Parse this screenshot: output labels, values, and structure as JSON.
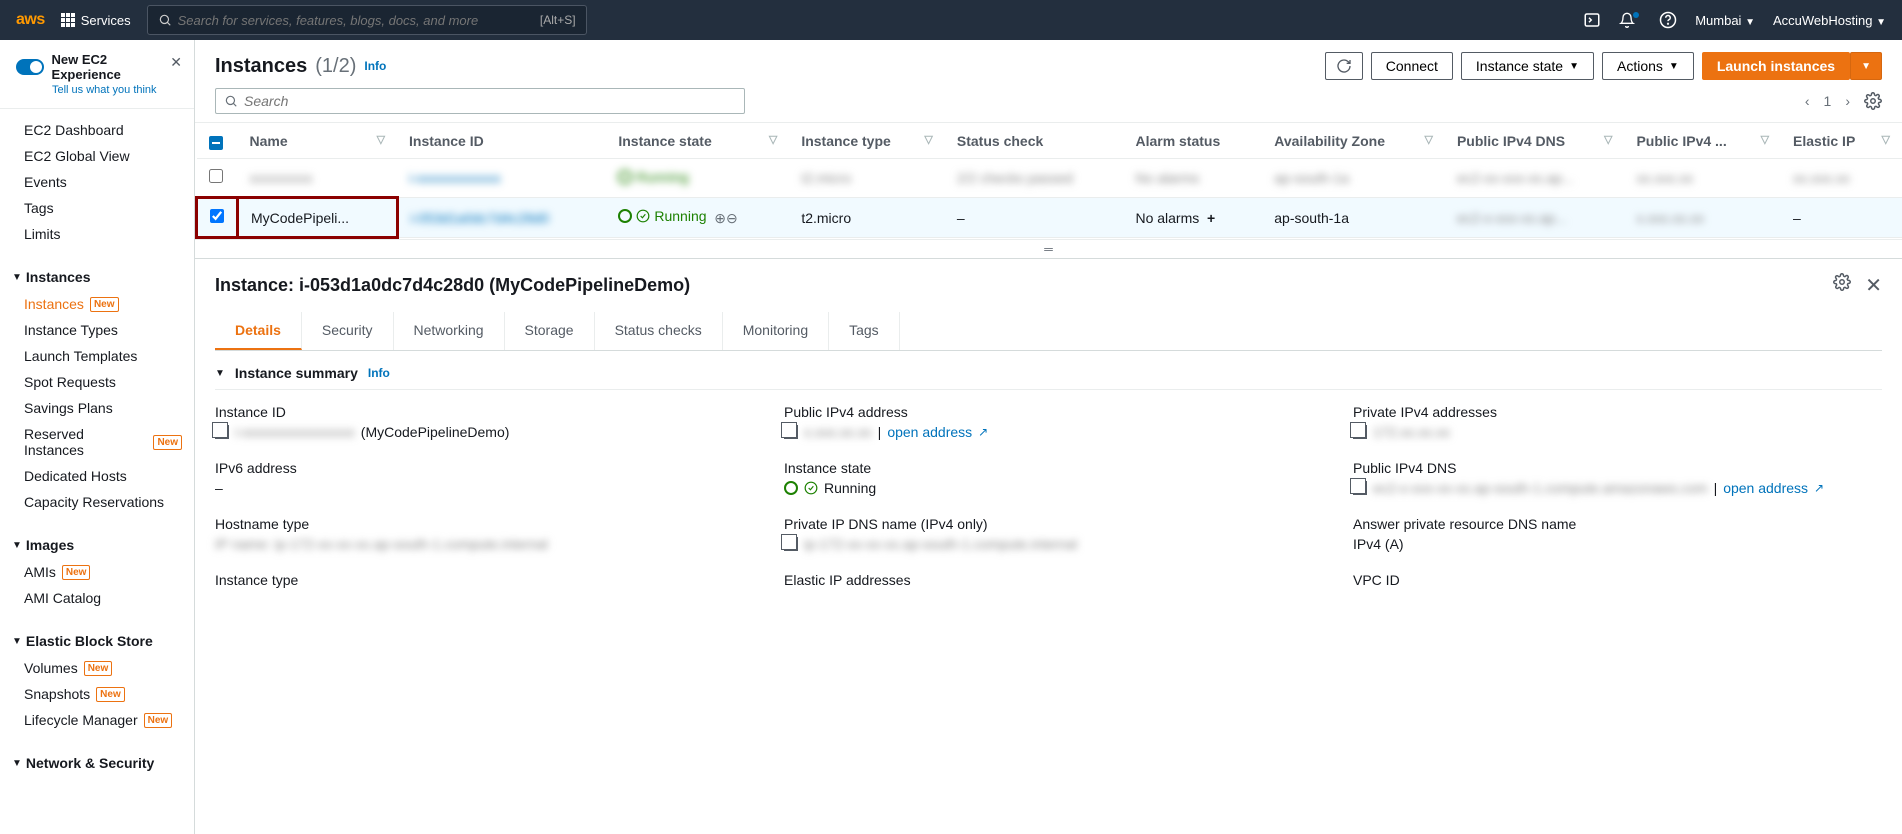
{
  "topnav": {
    "logo": "aws",
    "services": "Services",
    "search_placeholder": "Search for services, features, blogs, docs, and more",
    "search_shortcut": "[Alt+S]",
    "region": "Mumbai",
    "account": "AccuWebHosting"
  },
  "sidebar": {
    "new_experience_title": "New EC2 Experience",
    "new_experience_sub": "Tell us what you think",
    "top_items": [
      "EC2 Dashboard",
      "EC2 Global View",
      "Events",
      "Tags",
      "Limits"
    ],
    "sections": [
      {
        "title": "Instances",
        "items": [
          {
            "label": "Instances",
            "badge": "New",
            "active": true
          },
          {
            "label": "Instance Types"
          },
          {
            "label": "Launch Templates"
          },
          {
            "label": "Spot Requests"
          },
          {
            "label": "Savings Plans"
          },
          {
            "label": "Reserved Instances",
            "badge": "New"
          },
          {
            "label": "Dedicated Hosts"
          },
          {
            "label": "Capacity Reservations"
          }
        ]
      },
      {
        "title": "Images",
        "items": [
          {
            "label": "AMIs",
            "badge": "New"
          },
          {
            "label": "AMI Catalog"
          }
        ]
      },
      {
        "title": "Elastic Block Store",
        "items": [
          {
            "label": "Volumes",
            "badge": "New"
          },
          {
            "label": "Snapshots",
            "badge": "New"
          },
          {
            "label": "Lifecycle Manager",
            "badge": "New"
          }
        ]
      },
      {
        "title": "Network & Security",
        "items": []
      }
    ]
  },
  "header": {
    "title": "Instances",
    "count": "(1/2)",
    "info": "Info",
    "connect": "Connect",
    "instance_state": "Instance state",
    "actions": "Actions",
    "launch": "Launch instances"
  },
  "filter": {
    "placeholder": "Search",
    "page": "1"
  },
  "table": {
    "columns": [
      "Name",
      "Instance ID",
      "Instance state",
      "Instance type",
      "Status check",
      "Alarm status",
      "Availability Zone",
      "Public IPv4 DNS",
      "Public IPv4 ...",
      "Elastic IP"
    ],
    "rows": [
      {
        "selected": false,
        "blurred": true,
        "name": "xxxxxxxxx",
        "id": "i-xxxxxxxxxxxx",
        "state": "Running",
        "type": "t2.micro",
        "status": "2/2 checks passed",
        "alarms": "No alarms",
        "az": "ap-south-1a",
        "dns": "ec2-xx-xxx-xx.ap...",
        "ip": "xx.xxx.xx",
        "eip": "xx.xxx.xx"
      },
      {
        "selected": true,
        "name": "MyCodePipeli...",
        "id": "i-053d1a0dc7d4c28d0",
        "state": "Running",
        "type": "t2.micro",
        "status": "–",
        "alarms": "No alarms",
        "alarms_plus": "+",
        "az": "ap-south-1a",
        "dns": "ec2-x-xxx-xx.ap...",
        "ip": "x.xxx.xx.xx",
        "eip": "–"
      }
    ]
  },
  "detail": {
    "title": "Instance: i-053d1a0dc7d4c28d0 (MyCodePipelineDemo)",
    "tabs": [
      "Details",
      "Security",
      "Networking",
      "Storage",
      "Status checks",
      "Monitoring",
      "Tags"
    ],
    "summary_title": "Instance summary",
    "info": "Info",
    "fields": {
      "instance_id_label": "Instance ID",
      "instance_id_suffix": "(MyCodePipelineDemo)",
      "public_ipv4_label": "Public IPv4 address",
      "public_ipv4_sep": "|",
      "open_address": "open address",
      "private_ipv4_label": "Private IPv4 addresses",
      "ipv6_label": "IPv6 address",
      "ipv6_value": "–",
      "instance_state_label": "Instance state",
      "instance_state_value": "Running",
      "public_dns_label": "Public IPv4 DNS",
      "hostname_label": "Hostname type",
      "private_dns_label": "Private IP DNS name (IPv4 only)",
      "answer_dns_label": "Answer private resource DNS name",
      "answer_dns_value": "IPv4 (A)",
      "instance_type_label": "Instance type",
      "elastic_ip_label": "Elastic IP addresses",
      "vpc_id_label": "VPC ID"
    }
  }
}
